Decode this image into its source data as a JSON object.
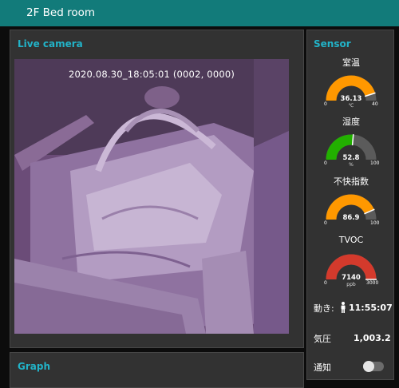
{
  "header": {
    "title": "2F Bed room"
  },
  "camera": {
    "title": "Live camera",
    "timestamp": "2020.08.30_18:05:01 (0002, 0000)"
  },
  "graph": {
    "title": "Graph"
  },
  "sensor": {
    "title": "Sensor",
    "gauges": [
      {
        "label": "室温",
        "value": "36.13",
        "unit": "℃",
        "min": "0",
        "max": "40",
        "fraction": 0.903,
        "color": "#ff9800"
      },
      {
        "label": "湿度",
        "value": "52.8",
        "unit": "%",
        "min": "0",
        "max": "100",
        "fraction": 0.528,
        "color": "#22b000"
      },
      {
        "label": "不快指数",
        "value": "86.9",
        "unit": "",
        "min": "0",
        "max": "100",
        "fraction": 0.869,
        "color": "#ff9800"
      },
      {
        "label": "TVOC",
        "value": "7140",
        "unit": "ppb",
        "min": "0",
        "max": "3000",
        "fraction": 1.0,
        "color": "#d43a2c"
      }
    ],
    "motion": {
      "label": "動き:",
      "value": "11:55:07",
      "icon": "person-icon"
    },
    "pressure": {
      "label": "気圧",
      "value": "1,003.2"
    },
    "notify": {
      "label": "通知",
      "enabled": false
    }
  }
}
